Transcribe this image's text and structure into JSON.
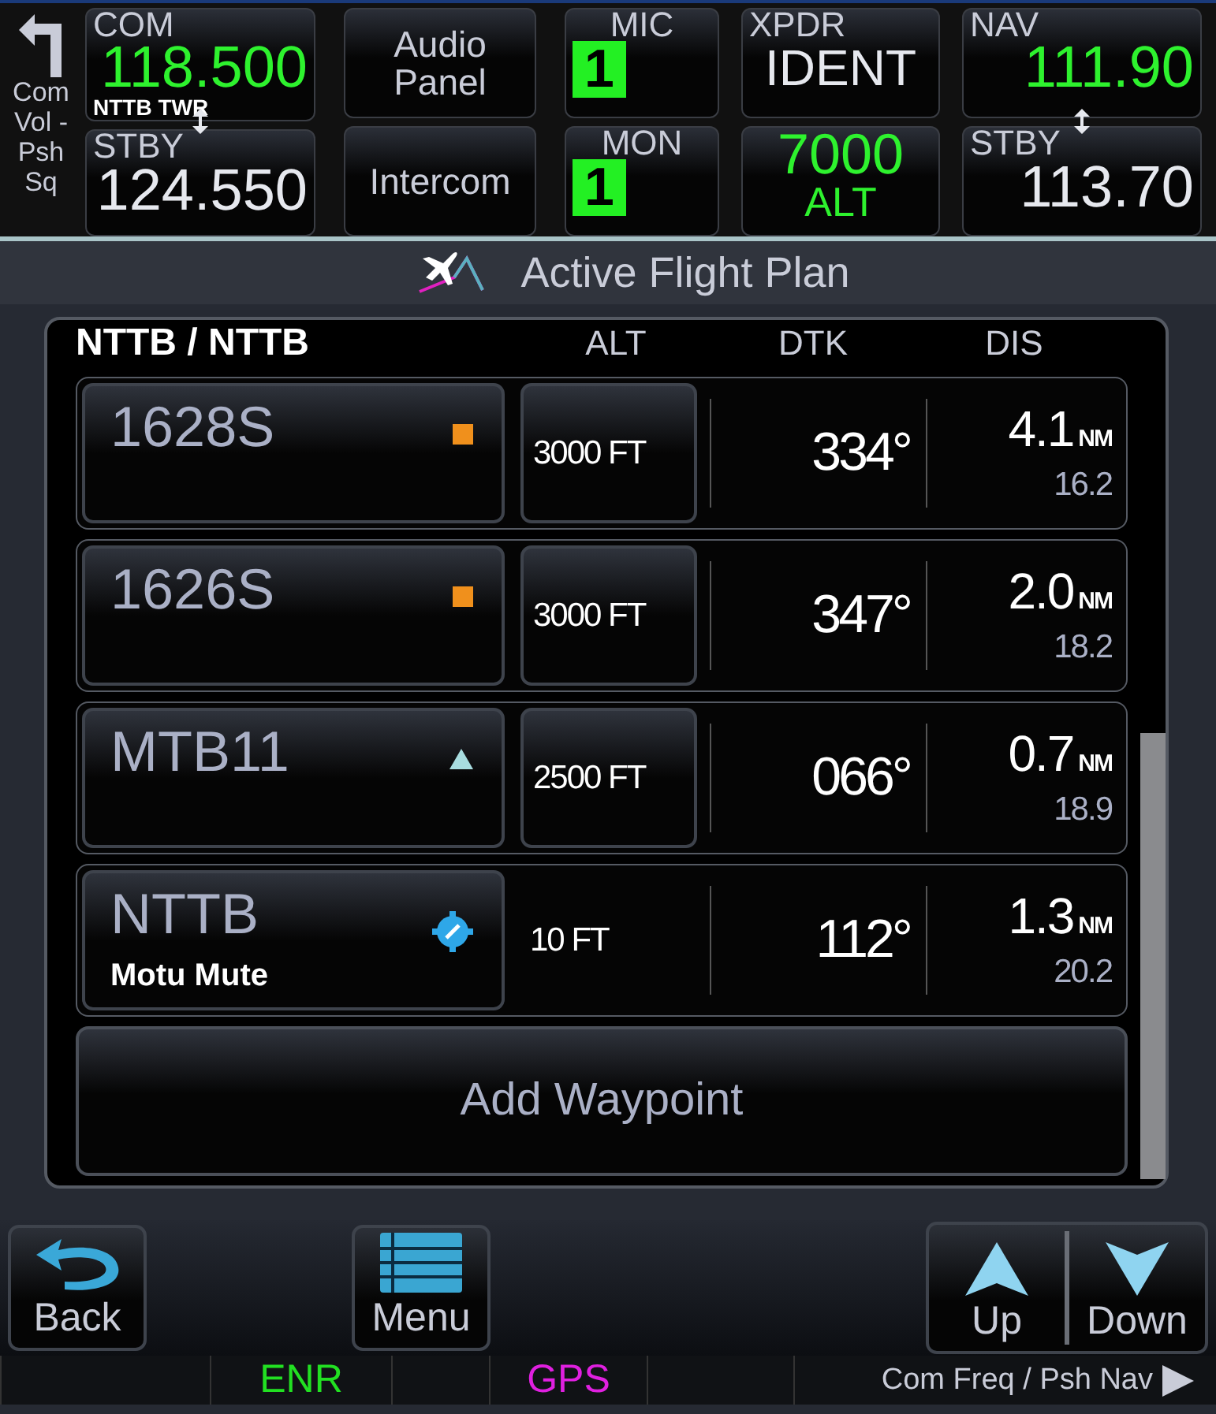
{
  "top_bar": {
    "side_label": "Com Vol - Psh Sq",
    "com": {
      "label": "COM",
      "active": "118.500",
      "station": "NTTB TWR",
      "standby_label": "STBY",
      "standby": "124.550"
    },
    "audio_buttons": [
      "Audio Panel",
      "Intercom"
    ],
    "mic": {
      "label": "MIC",
      "value": "1"
    },
    "mon": {
      "label": "MON",
      "value": "1"
    },
    "xpdr": {
      "label": "XPDR",
      "ident": "IDENT",
      "code": "7000",
      "mode": "ALT"
    },
    "nav": {
      "label": "NAV",
      "active": "111.90",
      "standby_label": "STBY",
      "standby": "113.70"
    }
  },
  "title": "Active Flight Plan",
  "flight_plan": {
    "route": "NTTB / NTTB",
    "columns": [
      "ALT",
      "DTK",
      "DIS"
    ],
    "waypoints": [
      {
        "name": "1628S",
        "kind": "intersection",
        "alt": "3000 FT",
        "alt_editable": true,
        "dtk": "334°",
        "dis": "4.1",
        "unit": "NM",
        "total": "16.2"
      },
      {
        "name": "1626S",
        "kind": "intersection",
        "alt": "3000 FT",
        "alt_editable": true,
        "dtk": "347°",
        "dis": "2.0",
        "unit": "NM",
        "total": "18.2"
      },
      {
        "name": "MTB11",
        "kind": "user",
        "alt": "2500 FT",
        "alt_editable": true,
        "dtk": "066°",
        "dis": "0.7",
        "unit": "NM",
        "total": "18.9"
      },
      {
        "name": "NTTB",
        "kind": "airport",
        "subtitle": "Motu Mute",
        "alt": "10 FT",
        "alt_editable": false,
        "dtk": "112°",
        "dis": "1.3",
        "unit": "NM",
        "total": "20.2"
      }
    ],
    "add_button": "Add Waypoint"
  },
  "bottom_buttons": [
    {
      "label": "Back",
      "kind": "back"
    },
    {
      "label": "Menu",
      "kind": "menu"
    },
    {
      "label": "Up",
      "kind": "up"
    },
    {
      "label": "Down",
      "kind": "down"
    }
  ],
  "status_bar": {
    "mode": "ENR",
    "source": "GPS",
    "hint": "Com Freq / Psh Nav"
  }
}
